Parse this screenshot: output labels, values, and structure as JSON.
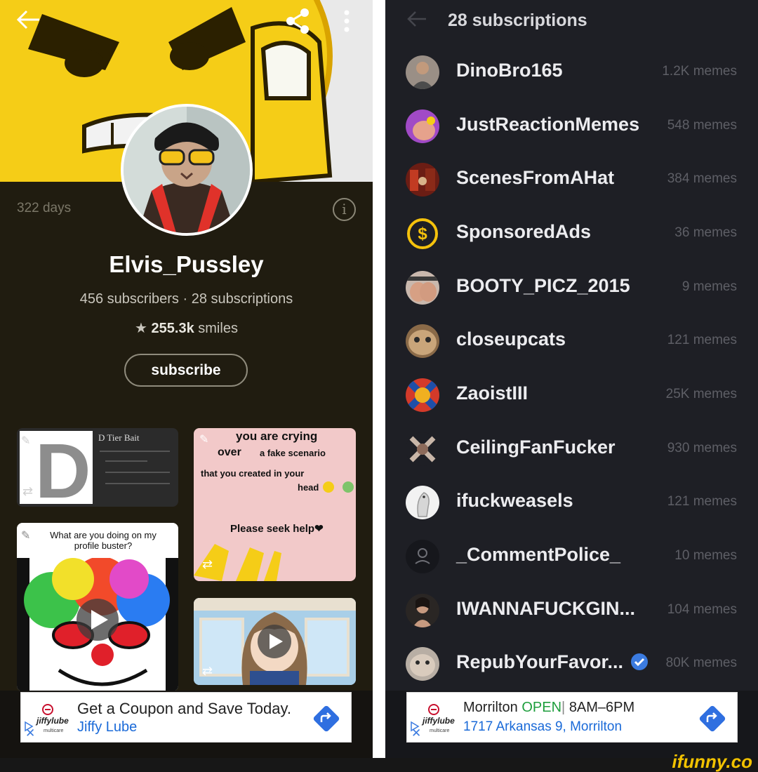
{
  "left": {
    "days": "322 days",
    "info_glyph": "i",
    "username": "Elvis_Pussley",
    "stats": "456 subscribers · 28 subscriptions",
    "smiles_value": "255.3k",
    "smiles_label": " smiles",
    "subscribe_label": "subscribe",
    "tiles": {
      "tier_title": "D Tier Bait",
      "tier_letter": "D",
      "crying_line1": "you are crying",
      "crying_line2": "over",
      "crying_line2b": "a fake scenario",
      "crying_line3": "that you created in your",
      "crying_line4": "head",
      "crying_line5": "Please seek help❤",
      "buster_caption": "What are you doing on my profile buster?"
    },
    "ad": {
      "title": "Get a Coupon and Save Today.",
      "subtitle": "Jiffy Lube",
      "logo_text": "jiffylube",
      "logo_sub": "multicare",
      "close": "✕"
    }
  },
  "right": {
    "title": "28 subscriptions",
    "rows": [
      {
        "name": "DinoBro165",
        "memes": "1.2K memes"
      },
      {
        "name": "JustReactionMemes",
        "memes": "548 memes"
      },
      {
        "name": "ScenesFromAHat",
        "memes": "384 memes"
      },
      {
        "name": "SponsoredAds",
        "memes": "36 memes"
      },
      {
        "name": "BOOTY_PICZ_2015",
        "memes": "9 memes"
      },
      {
        "name": "closeupcats",
        "memes": "121 memes"
      },
      {
        "name": "ZaoistIII",
        "memes": "25K memes"
      },
      {
        "name": "CeilingFanFucker",
        "memes": "930 memes"
      },
      {
        "name": "ifuckweasels",
        "memes": "121 memes"
      },
      {
        "name": "_CommentPolice_",
        "memes": "10 memes"
      },
      {
        "name": "IWANNAFUCKGIN...",
        "memes": "104 memes"
      },
      {
        "name": "RepubYourFavor...",
        "memes": "80K memes"
      }
    ],
    "ad": {
      "place": "Morrilton",
      "status": "OPEN",
      "divider": "|",
      "hours": "8AM–6PM",
      "address": "1717 Arkansas 9, Morrilton",
      "logo_text": "jiffylube",
      "logo_sub": "multicare",
      "close": "✕"
    }
  },
  "watermark": "ifunny.co",
  "colors": {
    "left_bg": "#201c10",
    "right_bg": "#1e1f25",
    "ad_link": "#1a6ad8",
    "open_green": "#1e9e3d",
    "watermark": "#f2c200"
  }
}
